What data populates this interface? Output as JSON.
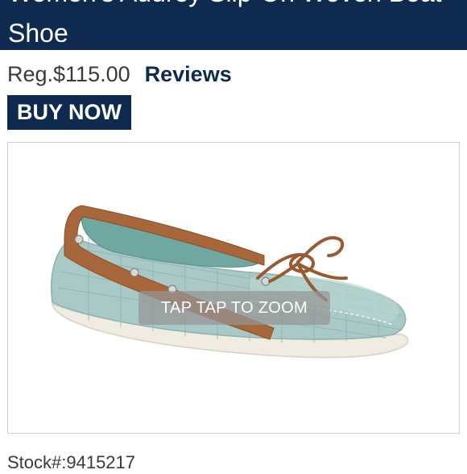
{
  "header": {
    "title": "Women's Audrey Slip-On Woven Boat Shoe"
  },
  "product": {
    "price": "Reg.$115.00",
    "reviews_label": "Reviews",
    "buy_label": "BUY NOW",
    "zoom_hint": "TAP TAP TO ZOOM",
    "stock": "Stock#:9415217"
  },
  "colors": {
    "header_bg": "#0e2a4f",
    "link": "#0e2a4f",
    "shoe_upper": "#a9c9c6",
    "shoe_trim": "#a8673a",
    "sole": "#f1ece1"
  }
}
